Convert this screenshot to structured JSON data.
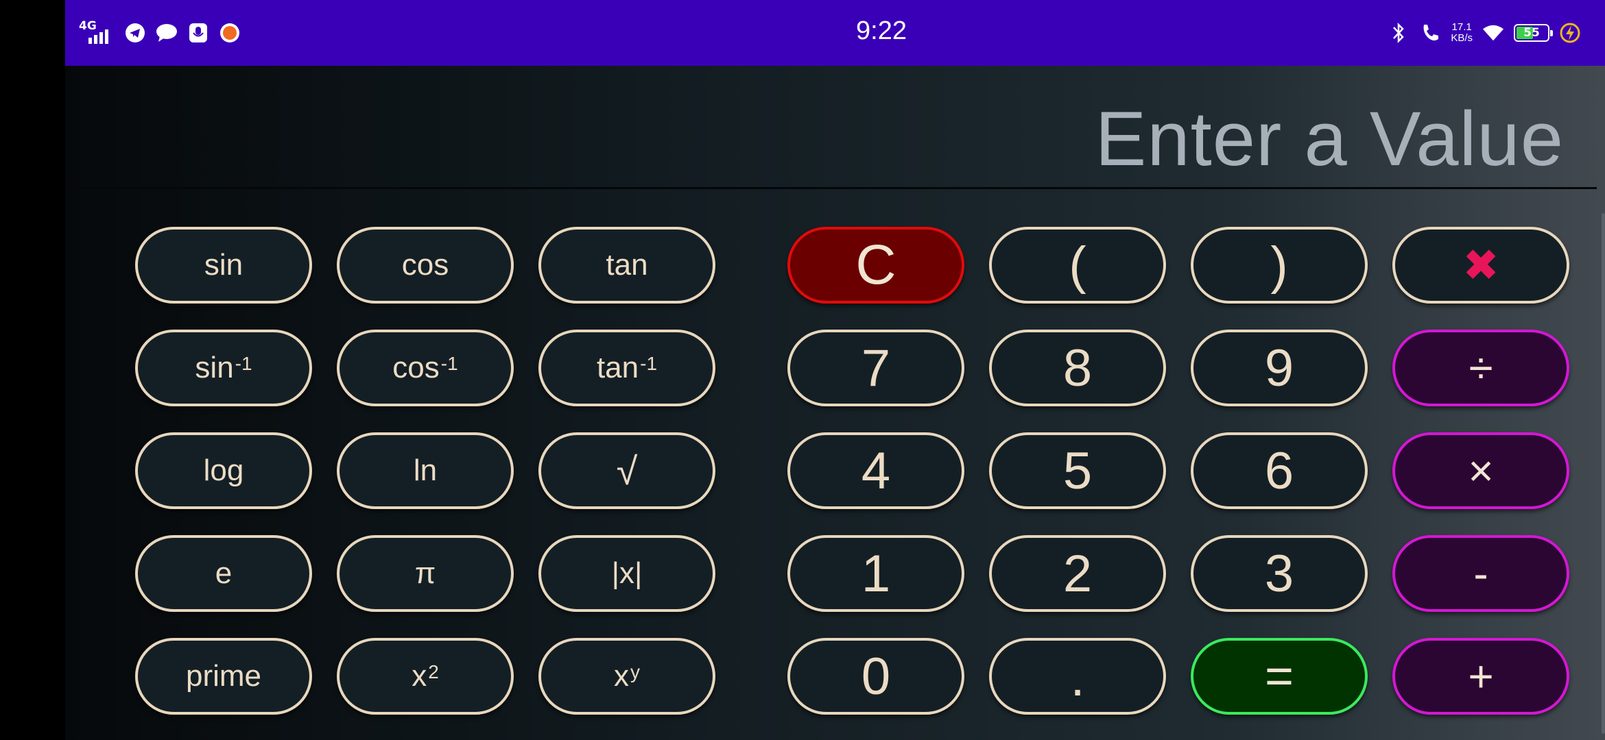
{
  "status_bar": {
    "network": "4G",
    "time": "9:22",
    "speed_value": "17.1",
    "speed_unit": "KB/s",
    "battery": "55",
    "battery_level": 0.55,
    "icons": [
      "signal-icon",
      "telegram-icon",
      "message-icon",
      "voice-recorder-icon",
      "app-notification-icon",
      "bluetooth-icon",
      "call-icon",
      "wifi-icon",
      "battery-icon",
      "charging-icon"
    ]
  },
  "display": {
    "placeholder": "Enter a Value"
  },
  "scientific": {
    "sin": "sin",
    "cos": "cos",
    "tan": "tan",
    "asin": "sin",
    "acos": "cos",
    "atan": "tan",
    "inv": "-1",
    "log": "log",
    "ln": "ln",
    "sqrt": "√",
    "e": "e",
    "pi": "π",
    "abs": "|x|",
    "prime": "prime",
    "x": "x",
    "sq": "2",
    "pow": "y"
  },
  "keypad": {
    "clear": "C",
    "lparen": "(",
    "rparen": ")",
    "backspace": "✖",
    "seven": "7",
    "eight": "8",
    "nine": "9",
    "divide": "÷",
    "four": "4",
    "five": "5",
    "six": "6",
    "multiply": "×",
    "one": "1",
    "two": "2",
    "three": "3",
    "minus": "-",
    "zero": "0",
    "dot": ".",
    "equals": "=",
    "plus": "+"
  },
  "colors": {
    "status_bar": "#3a00b8",
    "button_border": "#e8d7bd",
    "clear": "#e20a0a",
    "operator": "#d417d4",
    "equals": "#3bea5c",
    "backspace": "#e8155a"
  }
}
